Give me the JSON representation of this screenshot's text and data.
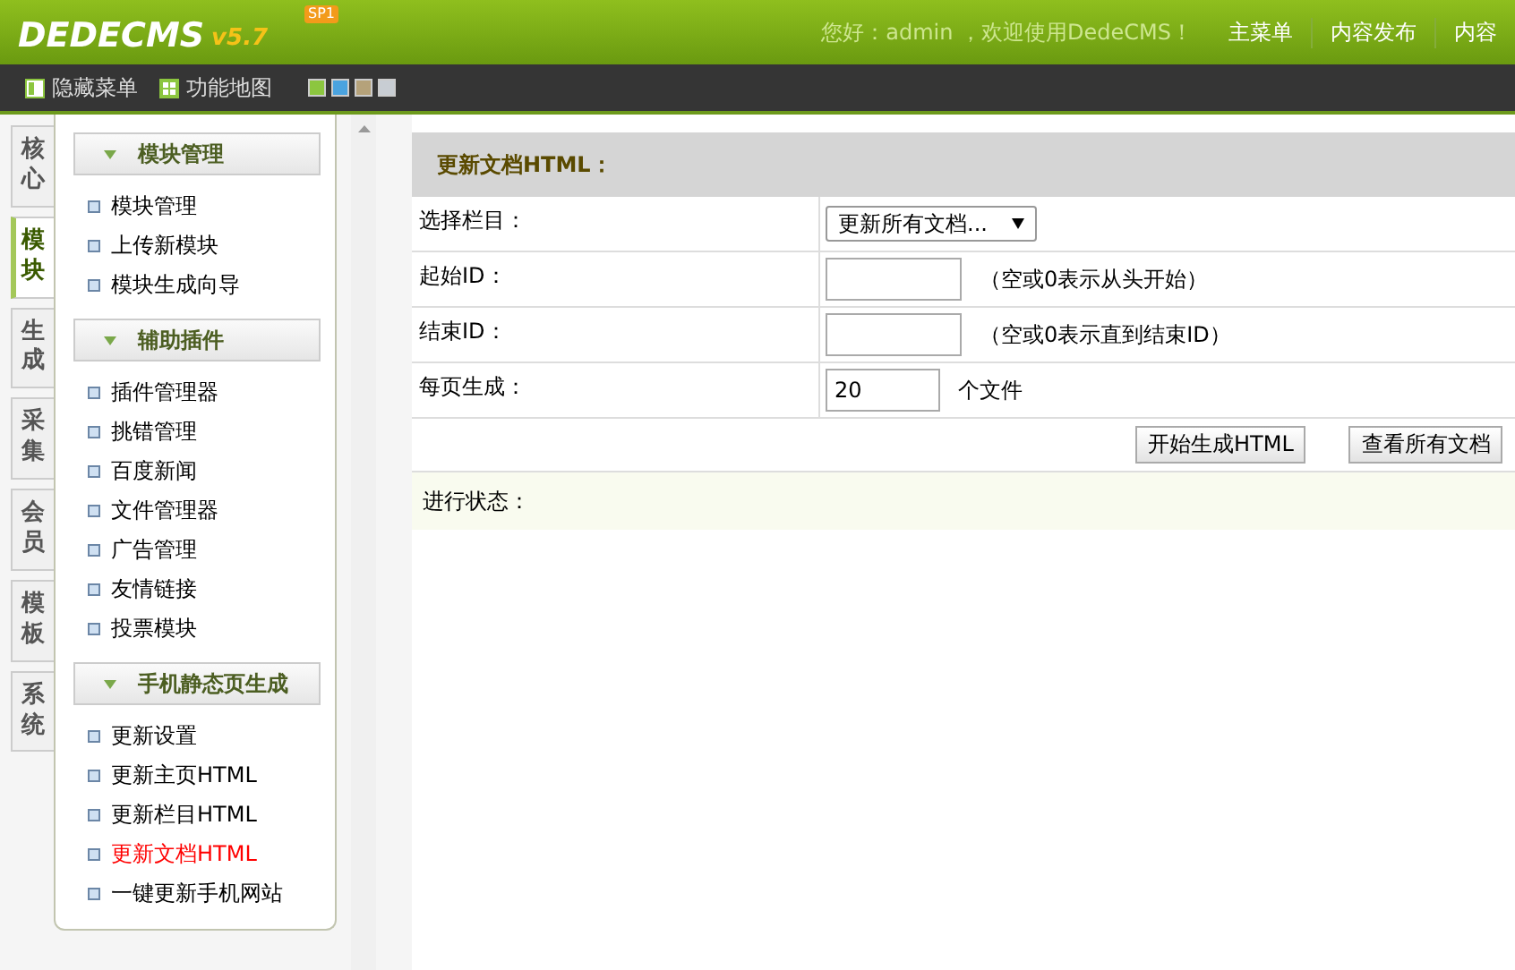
{
  "header": {
    "logo": "DEDECMS",
    "badge": "SP1",
    "version": "v5.7",
    "greeting": "您好：admin ，欢迎使用DedeCMS！",
    "nav": [
      "主菜单",
      "内容发布",
      "内容"
    ]
  },
  "toolbar": {
    "buttons": [
      {
        "label": "隐藏菜单",
        "kind": "hide"
      },
      {
        "label": "功能地图",
        "kind": "map"
      }
    ],
    "themes": [
      {
        "color": "#8cc63f"
      },
      {
        "color": "#4aa3df"
      },
      {
        "color": "#b5a27a"
      },
      {
        "color": "#c8cdd3"
      }
    ]
  },
  "side_tabs": [
    {
      "label": "核心",
      "selected": false
    },
    {
      "label": "模块",
      "selected": true
    },
    {
      "label": "生成",
      "selected": false
    },
    {
      "label": "采集",
      "selected": false
    },
    {
      "label": "会员",
      "selected": false
    },
    {
      "label": "模板",
      "selected": false
    },
    {
      "label": "系统",
      "selected": false
    }
  ],
  "menu_groups": [
    {
      "title": "模块管理",
      "items": [
        {
          "label": "模块管理",
          "selected": false
        },
        {
          "label": "上传新模块",
          "selected": false
        },
        {
          "label": "模块生成向导",
          "selected": false
        }
      ]
    },
    {
      "title": "辅助插件",
      "items": [
        {
          "label": "插件管理器",
          "selected": false
        },
        {
          "label": "挑错管理",
          "selected": false
        },
        {
          "label": "百度新闻",
          "selected": false
        },
        {
          "label": "文件管理器",
          "selected": false
        },
        {
          "label": "广告管理",
          "selected": false
        },
        {
          "label": "友情链接",
          "selected": false
        },
        {
          "label": "投票模块",
          "selected": false
        }
      ]
    },
    {
      "title": "手机静态页生成",
      "items": [
        {
          "label": "更新设置",
          "selected": false
        },
        {
          "label": "更新主页HTML",
          "selected": false
        },
        {
          "label": "更新栏目HTML",
          "selected": false
        },
        {
          "label": "更新文档HTML",
          "selected": true
        },
        {
          "label": "一键更新手机网站",
          "selected": false
        }
      ]
    }
  ],
  "form": {
    "title": "更新文档HTML：",
    "rows": [
      {
        "label": "选择栏目：",
        "kind": "select",
        "value": "更新所有文档..."
      },
      {
        "label": "起始ID：",
        "kind": "input",
        "hint": "（空或0表示从头开始）"
      },
      {
        "label": "结束ID：",
        "kind": "input",
        "hint": "（空或0表示直到结束ID）"
      },
      {
        "label": "每页生成：",
        "kind": "number",
        "value": "20",
        "hint": "个文件"
      }
    ],
    "buttons": [
      "开始生成HTML",
      "查看所有文档"
    ],
    "status_label": "进行状态："
  }
}
